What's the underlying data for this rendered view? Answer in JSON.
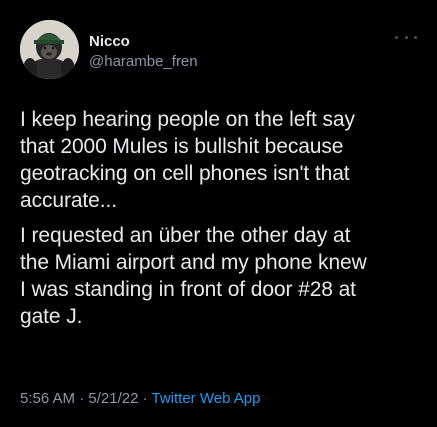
{
  "author": {
    "display_name": "Nicco",
    "handle": "@harambe_fren",
    "avatar_icon": "gorilla-avatar"
  },
  "more_icon": "more-options-icon",
  "tweet": {
    "paragraphs": [
      "I keep hearing people on the left say\nthat 2000 Mules is bullshit because\ngeotracking on cell phones isn't that\naccurate...",
      "I requested an über the other day at\nthe Miami airport and my phone knew\nI was standing in front of door #28 at\ngate J."
    ]
  },
  "meta": {
    "time": "5:56 AM",
    "separator1": " · ",
    "date": "5/21/22",
    "separator2": " · ",
    "source": "Twitter Web App"
  },
  "colors": {
    "background": "#000000",
    "primary_text": "#e7e9ea",
    "secondary_text": "#8b98a5",
    "link": "#1d9bf0"
  }
}
